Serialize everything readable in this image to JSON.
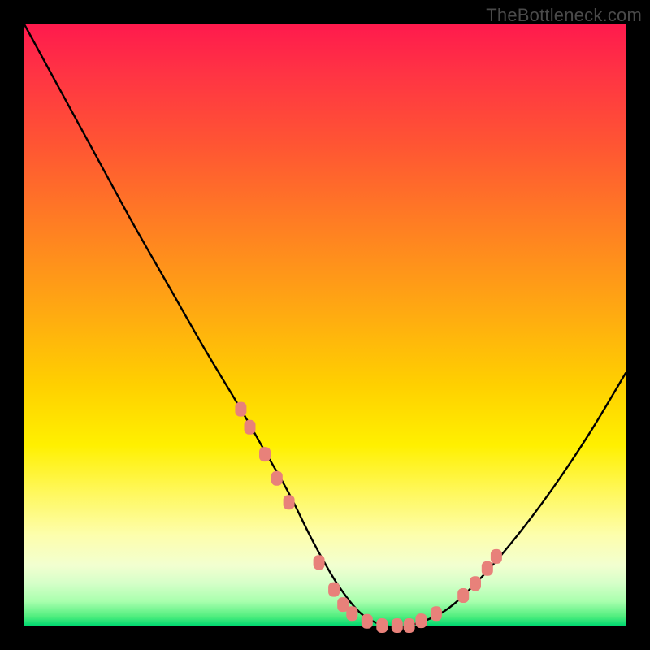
{
  "watermark": "TheBottleneck.com",
  "chart_data": {
    "type": "line",
    "title": "",
    "xlabel": "",
    "ylabel": "",
    "xlim": [
      0,
      100
    ],
    "ylim": [
      0,
      100
    ],
    "series": [
      {
        "name": "bottleneck-curve",
        "x": [
          0,
          6,
          12,
          18,
          24,
          30,
          36,
          40,
          44,
          48,
          52,
          56,
          60,
          64,
          70,
          76,
          82,
          88,
          94,
          100
        ],
        "values": [
          100,
          89,
          78,
          67,
          56.5,
          46,
          36,
          29,
          22,
          14,
          7,
          2,
          0,
          0,
          2.5,
          8,
          15,
          23,
          32,
          42
        ]
      }
    ],
    "markers": {
      "name": "highlight-segments",
      "color": "#e8817a",
      "points": [
        {
          "x": 36.0,
          "y": 36.0
        },
        {
          "x": 37.5,
          "y": 33.0
        },
        {
          "x": 40.0,
          "y": 28.5
        },
        {
          "x": 42.0,
          "y": 24.5
        },
        {
          "x": 44.0,
          "y": 20.5
        },
        {
          "x": 49.0,
          "y": 10.5
        },
        {
          "x": 51.5,
          "y": 6.0
        },
        {
          "x": 53.0,
          "y": 3.5
        },
        {
          "x": 54.5,
          "y": 2.0
        },
        {
          "x": 57.0,
          "y": 0.7
        },
        {
          "x": 59.5,
          "y": 0.0
        },
        {
          "x": 62.0,
          "y": 0.0
        },
        {
          "x": 64.0,
          "y": 0.0
        },
        {
          "x": 66.0,
          "y": 0.8
        },
        {
          "x": 68.5,
          "y": 2.0
        },
        {
          "x": 73.0,
          "y": 5.0
        },
        {
          "x": 75.0,
          "y": 7.0
        },
        {
          "x": 77.0,
          "y": 9.5
        },
        {
          "x": 78.5,
          "y": 11.5
        }
      ]
    }
  }
}
